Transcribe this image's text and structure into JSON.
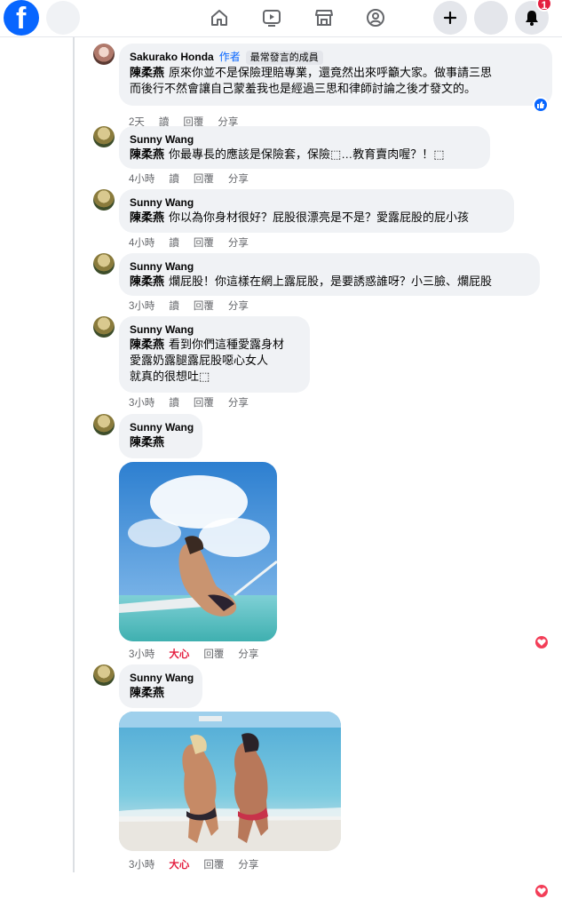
{
  "notifications": {
    "count": "1"
  },
  "comments": [
    {
      "author": "Sakurako Honda",
      "author_tag": "作者",
      "member_tag": "最常發言的成員",
      "mention": "陳柔燕",
      "lines": [
        "原來你並不是保險理賠專業，還竟然出來呼籲大家。做事請三思",
        "而後行不然會讓自己蒙羞我也是經過三思和律師討論之後才發文的。"
      ],
      "time": "2天",
      "read": "讀",
      "reply": "回覆",
      "share": "分享"
    },
    {
      "author": "Sunny Wang",
      "mention": "陳柔燕",
      "lines": [
        "你最專長的應該是保險套，保險⬚…教育賣肉喔？！⬚"
      ],
      "time": "4小時",
      "read": "讀",
      "reply": "回覆",
      "share": "分享"
    },
    {
      "author": "Sunny Wang",
      "mention": "陳柔燕",
      "lines": [
        "你以為你身材很好？屁股很漂亮是不是？愛露屁股的屁小孩"
      ],
      "time": "4小時",
      "read": "讀",
      "reply": "回覆",
      "share": "分享"
    },
    {
      "author": "Sunny Wang",
      "mention": "陳柔燕",
      "lines": [
        "爛屁股！你這樣在網上露屁股，是要誘惑誰呀？小三臉、爛屁股"
      ],
      "time": "3小時",
      "read": "讀",
      "reply": "回覆",
      "share": "分享"
    },
    {
      "author": "Sunny Wang",
      "mention": "陳柔燕",
      "lines": [
        "看到你們這種愛露身材",
        "愛露奶露腿露屁股噁心女人",
        "就真的很想吐⬚"
      ],
      "time": "3小時",
      "read": "讀",
      "reply": "回覆",
      "share": "分享"
    },
    {
      "author": "Sunny Wang",
      "mention": "陳柔燕",
      "time": "3小時",
      "love": "大心",
      "reply": "回覆",
      "share": "分享"
    },
    {
      "author": "Sunny Wang",
      "mention": "陳柔燕",
      "time": "3小時",
      "love": "大心",
      "reply": "回覆",
      "share": "分享"
    }
  ],
  "colors": {
    "brand": "#0866ff",
    "love": "#e41e3f",
    "bubble": "#f0f2f5",
    "meta": "#65676b"
  },
  "icons": [
    "facebook-logo-icon",
    "home-icon",
    "video-icon",
    "marketplace-icon",
    "groups-icon",
    "plus-icon",
    "bell-icon",
    "like-reaction-icon",
    "heart-reaction-icon"
  ]
}
